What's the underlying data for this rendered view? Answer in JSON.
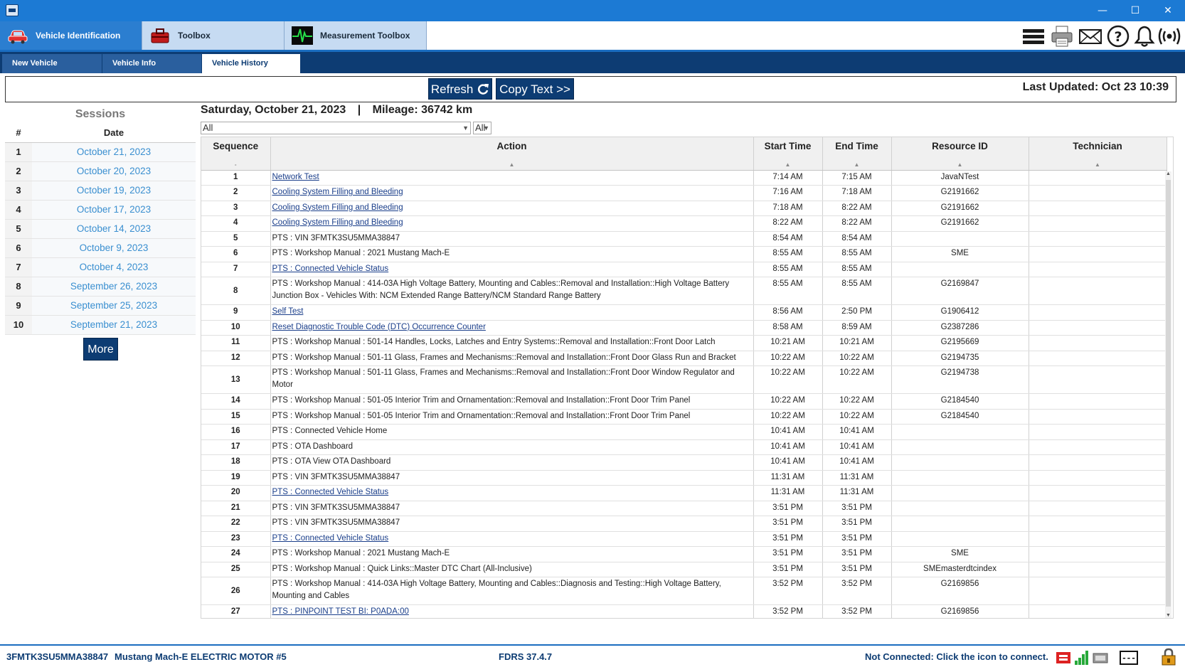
{
  "window": {
    "minimize": "—",
    "maximize": "☐",
    "close": "✕"
  },
  "ribbon": {
    "tabs": [
      {
        "label": "Vehicle Identification",
        "icon": "car-icon"
      },
      {
        "label": "Toolbox",
        "icon": "toolbox-icon"
      },
      {
        "label": "Measurement Toolbox",
        "icon": "oscilloscope-icon"
      }
    ],
    "toolbar_icons": [
      "menu-icon",
      "printer-icon",
      "mail-icon",
      "help-icon",
      "bell-icon",
      "wireless-icon"
    ],
    "help_glyph": "?"
  },
  "subtabs": [
    "New Vehicle",
    "Vehicle Info",
    "Vehicle History"
  ],
  "toolbar": {
    "refresh_label": "Refresh",
    "copy_label": "Copy Text >>",
    "last_updated": "Last Updated: Oct 23 10:39"
  },
  "sessions": {
    "title": "Sessions",
    "col_num": "#",
    "col_date": "Date",
    "more_label": "More",
    "rows": [
      {
        "num": "1",
        "date": "October 21, 2023"
      },
      {
        "num": "2",
        "date": "October 20, 2023"
      },
      {
        "num": "3",
        "date": "October 19, 2023"
      },
      {
        "num": "4",
        "date": "October 17, 2023"
      },
      {
        "num": "5",
        "date": "October 14, 2023"
      },
      {
        "num": "6",
        "date": "October 9, 2023"
      },
      {
        "num": "7",
        "date": "October 4, 2023"
      },
      {
        "num": "8",
        "date": "September 26, 2023"
      },
      {
        "num": "9",
        "date": "September 25, 2023"
      },
      {
        "num": "10",
        "date": "September 21, 2023"
      }
    ]
  },
  "history": {
    "date_heading": "Saturday, October 21, 2023",
    "separator": "|",
    "mileage": "Mileage: 36742 km",
    "filter_action": "All",
    "filter_other": "All",
    "columns": [
      "Sequence",
      "Action",
      "Start Time",
      "End Time",
      "Resource ID",
      "Technician"
    ],
    "sort_marks": [
      "-",
      "▲",
      "▲",
      "▲",
      "▲",
      "▲"
    ],
    "rows": [
      {
        "seq": "1",
        "action": "Network Test",
        "link": true,
        "start": "7:14 AM",
        "end": "7:15 AM",
        "resource": "JavaNTest",
        "tech": ""
      },
      {
        "seq": "2",
        "action": "Cooling System Filling and Bleeding",
        "link": true,
        "start": "7:16 AM",
        "end": "7:18 AM",
        "resource": "G2191662",
        "tech": ""
      },
      {
        "seq": "3",
        "action": "Cooling System Filling and Bleeding",
        "link": true,
        "start": "7:18 AM",
        "end": "8:22 AM",
        "resource": "G2191662",
        "tech": ""
      },
      {
        "seq": "4",
        "action": "Cooling System Filling and Bleeding",
        "link": true,
        "start": "8:22 AM",
        "end": "8:22 AM",
        "resource": "G2191662",
        "tech": ""
      },
      {
        "seq": "5",
        "action": "PTS : VIN 3FMTK3SU5MMA38847",
        "link": false,
        "start": "8:54 AM",
        "end": "8:54 AM",
        "resource": "",
        "tech": ""
      },
      {
        "seq": "6",
        "action": "PTS : Workshop Manual : 2021 Mustang Mach-E",
        "link": false,
        "start": "8:55 AM",
        "end": "8:55 AM",
        "resource": "SME",
        "tech": ""
      },
      {
        "seq": "7",
        "action": "PTS : Connected Vehicle Status",
        "link": true,
        "start": "8:55 AM",
        "end": "8:55 AM",
        "resource": "",
        "tech": ""
      },
      {
        "seq": "8",
        "action": "PTS : Workshop Manual : 414-03A High Voltage Battery, Mounting and Cables::Removal and Installation::High Voltage Battery Junction Box - Vehicles With: NCM Extended Range Battery/NCM Standard Range Battery",
        "link": false,
        "tall": true,
        "start": "8:55 AM",
        "end": "8:55 AM",
        "resource": "G2169847",
        "tech": ""
      },
      {
        "seq": "9",
        "action": "Self Test",
        "link": true,
        "start": "8:56 AM",
        "end": "2:50 PM",
        "resource": "G1906412",
        "tech": ""
      },
      {
        "seq": "10",
        "action": "Reset Diagnostic Trouble Code (DTC) Occurrence Counter",
        "link": true,
        "start": "8:58 AM",
        "end": "8:59 AM",
        "resource": "G2387286",
        "tech": ""
      },
      {
        "seq": "11",
        "action": "PTS : Workshop Manual : 501-14 Handles, Locks, Latches and Entry Systems::Removal and Installation::Front Door Latch",
        "link": false,
        "start": "10:21 AM",
        "end": "10:21 AM",
        "resource": "G2195669",
        "tech": ""
      },
      {
        "seq": "12",
        "action": "PTS : Workshop Manual : 501-11 Glass, Frames and Mechanisms::Removal and Installation::Front Door Glass Run and Bracket",
        "link": false,
        "start": "10:22 AM",
        "end": "10:22 AM",
        "resource": "G2194735",
        "tech": ""
      },
      {
        "seq": "13",
        "action": "PTS : Workshop Manual : 501-11 Glass, Frames and Mechanisms::Removal and Installation::Front Door Window Regulator and Motor",
        "link": false,
        "tall": true,
        "start": "10:22 AM",
        "end": "10:22 AM",
        "resource": "G2194738",
        "tech": ""
      },
      {
        "seq": "14",
        "action": "PTS : Workshop Manual : 501-05 Interior Trim and Ornamentation::Removal and Installation::Front Door Trim Panel",
        "link": false,
        "start": "10:22 AM",
        "end": "10:22 AM",
        "resource": "G2184540",
        "tech": ""
      },
      {
        "seq": "15",
        "action": "PTS : Workshop Manual : 501-05 Interior Trim and Ornamentation::Removal and Installation::Front Door Trim Panel",
        "link": false,
        "start": "10:22 AM",
        "end": "10:22 AM",
        "resource": "G2184540",
        "tech": ""
      },
      {
        "seq": "16",
        "action": "PTS : Connected Vehicle Home",
        "link": false,
        "start": "10:41 AM",
        "end": "10:41 AM",
        "resource": "",
        "tech": ""
      },
      {
        "seq": "17",
        "action": "PTS : OTA Dashboard",
        "link": false,
        "start": "10:41 AM",
        "end": "10:41 AM",
        "resource": "",
        "tech": ""
      },
      {
        "seq": "18",
        "action": "PTS : OTA View OTA Dashboard",
        "link": false,
        "start": "10:41 AM",
        "end": "10:41 AM",
        "resource": "",
        "tech": ""
      },
      {
        "seq": "19",
        "action": "PTS : VIN 3FMTK3SU5MMA38847",
        "link": false,
        "start": "11:31 AM",
        "end": "11:31 AM",
        "resource": "",
        "tech": ""
      },
      {
        "seq": "20",
        "action": "PTS : Connected Vehicle Status",
        "link": true,
        "start": "11:31 AM",
        "end": "11:31 AM",
        "resource": "",
        "tech": ""
      },
      {
        "seq": "21",
        "action": "PTS : VIN 3FMTK3SU5MMA38847",
        "link": false,
        "start": "3:51 PM",
        "end": "3:51 PM",
        "resource": "",
        "tech": ""
      },
      {
        "seq": "22",
        "action": "PTS : VIN 3FMTK3SU5MMA38847",
        "link": false,
        "start": "3:51 PM",
        "end": "3:51 PM",
        "resource": "",
        "tech": ""
      },
      {
        "seq": "23",
        "action": "PTS : Connected Vehicle Status",
        "link": true,
        "start": "3:51 PM",
        "end": "3:51 PM",
        "resource": "",
        "tech": ""
      },
      {
        "seq": "24",
        "action": "PTS : Workshop Manual : 2021 Mustang Mach-E",
        "link": false,
        "start": "3:51 PM",
        "end": "3:51 PM",
        "resource": "SME",
        "tech": ""
      },
      {
        "seq": "25",
        "action": "PTS : Workshop Manual : Quick Links::Master DTC Chart (All-Inclusive)",
        "link": false,
        "start": "3:51 PM",
        "end": "3:51 PM",
        "resource": "SMEmasterdtcindex",
        "tech": ""
      },
      {
        "seq": "26",
        "action": "PTS : Workshop Manual : 414-03A High Voltage Battery, Mounting and Cables::Diagnosis and Testing::High Voltage Battery, Mounting and Cables",
        "link": false,
        "tall": true,
        "start": "3:52 PM",
        "end": "3:52 PM",
        "resource": "G2169856",
        "tech": ""
      },
      {
        "seq": "27",
        "action": "PTS : PINPOINT TEST BI: P0ADA:00",
        "link": true,
        "start": "3:52 PM",
        "end": "3:52 PM",
        "resource": "G2169856",
        "tech": ""
      }
    ]
  },
  "status": {
    "vin": "3FMTK3SU5MMA38847",
    "vehicle": "Mustang Mach-E ELECTRIC MOTOR #5",
    "version": "FDRS 37.4.7",
    "connection": "Not Connected: Click the icon to connect.",
    "dashes": "---",
    "icons": [
      "vci-icon",
      "signal-icon",
      "battery-icon",
      "keyboard-icon",
      "lock-icon"
    ]
  },
  "colors": {
    "accent": "#1c7ad4",
    "navy": "#0d3c73",
    "link": "#1a3e8a",
    "date_link": "#3a8fd0"
  }
}
